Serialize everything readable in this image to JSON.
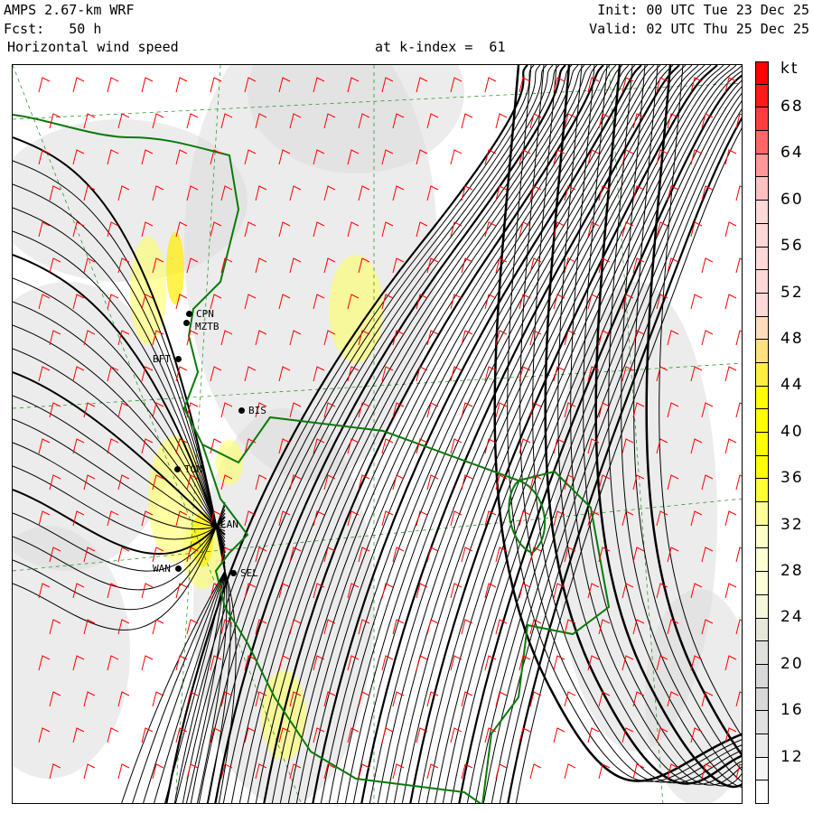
{
  "header": {
    "model": "AMPS 2.67-km WRF",
    "forecast": "Fcst:   50 h",
    "field": "Horizontal wind speed",
    "level": "at k-index =  61",
    "init": "Init: 00 UTC Tue 23 Dec 25",
    "valid": "Valid: 02 UTC Thu 25 Dec 25"
  },
  "colorbar": {
    "unit": "kt",
    "labels": [
      "68",
      "64",
      "60",
      "56",
      "52",
      "48",
      "44",
      "40",
      "36",
      "32",
      "28",
      "24",
      "20",
      "16",
      "12"
    ],
    "colors": [
      "#ff0000",
      "#ff1a1a",
      "#ff3d3d",
      "#ff6666",
      "#ff9999",
      "#ffc0c0",
      "#ffd8d8",
      "#ffd8d8",
      "#ffd8d8",
      "#ffd8d8",
      "#ffd8d8",
      "#ffdcbb",
      "#ffe080",
      "#ffee44",
      "#ffff00",
      "#ffff00",
      "#ffff00",
      "#ffff00",
      "#ffff33",
      "#ffff99",
      "#ffffcc",
      "#ffffd4",
      "#ffffd8",
      "#f7f7dd",
      "#e8e8d8",
      "#e0e0dc",
      "#d8d8d8",
      "#d8d8d8",
      "#e0e0e0",
      "#eaeaea",
      "#f5f5f5",
      "#ffffff"
    ]
  },
  "stations": [
    {
      "id": "CPN",
      "label": "CPN"
    },
    {
      "id": "MZTB",
      "label": "MZTB"
    },
    {
      "id": "BFT",
      "label": "BFT"
    },
    {
      "id": "BIS",
      "label": "BIS"
    },
    {
      "id": "TOM",
      "label": "TOM"
    },
    {
      "id": "LAN",
      "label": "LAN"
    },
    {
      "id": "WAN",
      "label": "WAN"
    },
    {
      "id": "SEL",
      "label": "SEL"
    }
  ]
}
